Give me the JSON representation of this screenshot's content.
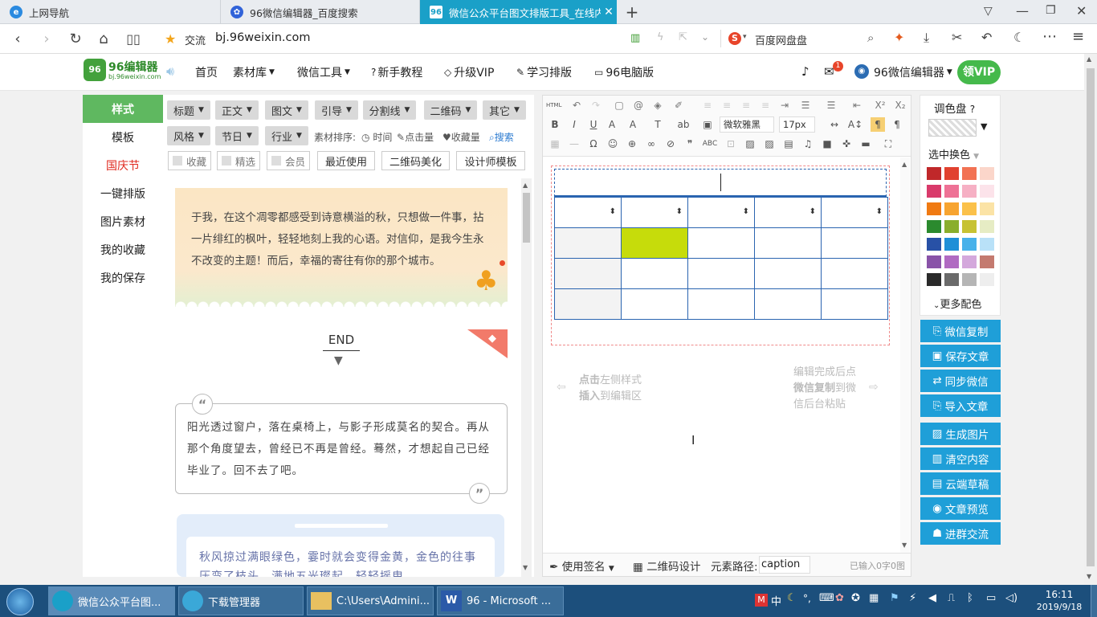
{
  "browser": {
    "tabs": [
      {
        "label": "上网导航",
        "icon": "ie-icon"
      },
      {
        "label": "96微信编辑器_百度搜索",
        "icon": "baidu-paw-icon"
      },
      {
        "label": "微信公众平台图文排版工具_在线内容",
        "icon": "96-logo-icon"
      }
    ],
    "new_tab": "+",
    "address_star_label": "交流",
    "url": "bj.96weixin.com",
    "search_engine_label": "百度网盘盘"
  },
  "site": {
    "logo_title": "96编辑器",
    "logo_sub": "bj.96weixin.com",
    "menu": [
      "首页",
      "素材库",
      "微信工具",
      "新手教程",
      "升级VIP",
      "学习排版",
      "96电脑版"
    ],
    "notification_count": "1",
    "account_label": "96微信编辑器",
    "vip_badge": "领VIP"
  },
  "leftnav": {
    "items": [
      "样式",
      "模板",
      "国庆节",
      "一键排版",
      "图片素材",
      "我的收藏",
      "我的保存"
    ]
  },
  "filters": {
    "row1": [
      "标题",
      "正文",
      "图文",
      "引导",
      "分割线",
      "二维码",
      "其它"
    ],
    "row2": [
      "风格",
      "节日",
      "行业"
    ],
    "sort_label": "素材排序:",
    "sort_options": [
      "时间",
      "点击量",
      "收藏量"
    ],
    "search_label": "搜索",
    "row3_checks": [
      "收藏",
      "精选",
      "会员"
    ],
    "row3_buttons": [
      "最近使用",
      "二维码美化",
      "设计师模板"
    ]
  },
  "materials": {
    "card1_text": "于我，在这个凋零都感受到诗意横溢的秋，只想做一件事，拈一片绯红的枫叶，轻轻地刻上我的心语。对信仰，是我今生永不改变的主题！而后，幸福的寄往有你的那个城市。",
    "end_label": "END",
    "quote_text": "阳光透过窗户，落在桌椅上，与影子形成莫名的契合。再从那个角度望去，曾经已不再是曾经。蓦然，才想起自己已经毕业了。回不去了吧。",
    "card3_text": "秋风掠过满眼绿色，霎时就会变得金黄，金色的往事压弯了枝头，满地五光璨起，轻轻摇曳"
  },
  "editor": {
    "toolbar_html": "HTML",
    "font_name": "微软雅黑",
    "font_size": "17px",
    "hint_left": [
      "点击",
      "左侧样式",
      "插入",
      "到编辑区"
    ],
    "hint_right": [
      "编辑完成后点",
      "微信复制",
      "到微",
      "信后台粘贴"
    ],
    "status_signature": "使用签名",
    "status_qr": "二维码设计",
    "status_path_label": "元素路径:",
    "status_path_value": "caption",
    "status_count": "已输入0字0图"
  },
  "palette": {
    "title": "调色盘",
    "swap_label": "选中换色",
    "more_label": "更多配色",
    "colors": [
      [
        "#c0282a",
        "#e1412f",
        "#f27253",
        "#fbd6ca"
      ],
      [
        "#d93a6b",
        "#ee7195",
        "#f6b0c4",
        "#fce3ea"
      ],
      [
        "#f07a12",
        "#f7a430",
        "#fbc14a",
        "#fbe3a6"
      ],
      [
        "#2b8a2e",
        "#8aae2c",
        "#c7c233",
        "#e6ecc4"
      ],
      [
        "#2851a6",
        "#1f8fd7",
        "#48b1ea",
        "#b9e1f8"
      ],
      [
        "#8953a8",
        "#b06ac2",
        "#d4a8dc",
        "#c47a6f"
      ],
      [
        "#2a2a2a",
        "#6a6a6a",
        "#b5b5b5",
        "#eeeeee"
      ]
    ]
  },
  "actions": [
    "微信复制",
    "保存文章",
    "同步微信",
    "导入文章",
    "生成图片",
    "清空内容",
    "云端草稿",
    "文章预览",
    "进群交流"
  ],
  "taskbar": {
    "tasks": [
      "微信公众平台图...",
      "下载管理器",
      "C:\\Users\\Admini...",
      "96 - Microsoft ..."
    ],
    "time": "16:11",
    "date": "2019/9/18",
    "ime": "中"
  }
}
